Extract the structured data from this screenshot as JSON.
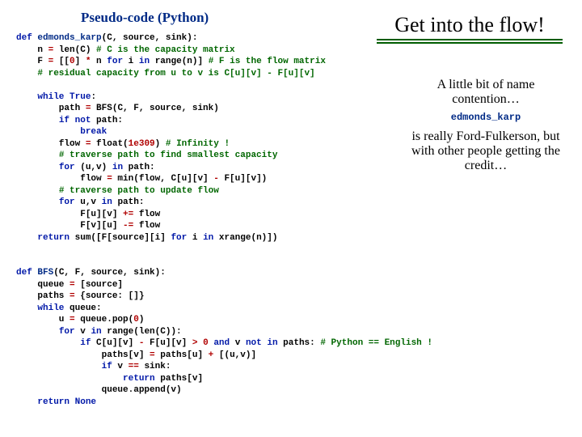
{
  "heading_left": "Pseudo-code (Python)",
  "title": "Get into the flow!",
  "aside": {
    "line1": "A little bit of name contention…",
    "fn": "edmonds_karp",
    "line2": "is really Ford-Fulkerson, but with other people getting the credit…"
  },
  "code": {
    "l01": "def edmonds_karp(C, source, sink):",
    "l02": "    n = len(C) # C is the capacity matrix",
    "l03": "    F = [[0] * n for i in range(n)] # F is the flow matrix",
    "l04": "    # residual capacity from u to v is C[u][v] - F[u][v]",
    "l06": "    while True:",
    "l07": "        path = BFS(C, F, source, sink)",
    "l08": "        if not path:",
    "l09": "            break",
    "l10": "        flow = float(1e309) # Infinity !",
    "l11": "        # traverse path to find smallest capacity",
    "l12": "        for (u,v) in path:",
    "l13": "            flow = min(flow, C[u][v] - F[u][v])",
    "l14": "        # traverse path to update flow",
    "l15": "        for u,v in path:",
    "l16": "            F[u][v] += flow",
    "l17": "            F[v][u] -= flow",
    "l18": "    return sum([F[source][i] for i in xrange(n)])",
    "b01": "def BFS(C, F, source, sink):",
    "b02": "    queue = [source]",
    "b03": "    paths = {source: []}",
    "b04": "    while queue:",
    "b05": "        u = queue.pop(0)",
    "b06": "        for v in range(len(C)):",
    "b07": "            if C[u][v] - F[u][v] > 0 and v not in paths: # Python == English !",
    "b08": "                paths[v] = paths[u] + [(u,v)]",
    "b09": "                if v == sink:",
    "b10": "                    return paths[v]",
    "b11": "                queue.append(v)",
    "b12": "    return None"
  }
}
